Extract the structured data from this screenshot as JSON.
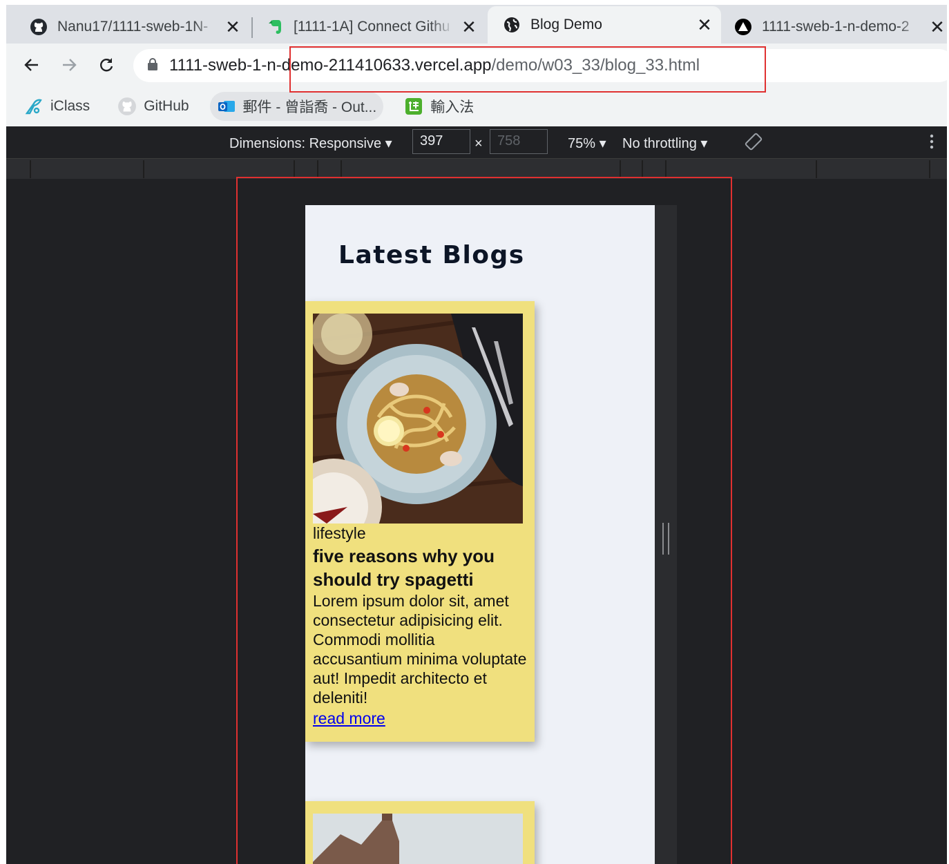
{
  "browser": {
    "tabs": [
      {
        "title": "Nanu17/1111-sweb-1N-",
        "icon": "github-icon",
        "active": false
      },
      {
        "title": "[1111-1A] Connect Githu",
        "icon": "evernote-icon",
        "active": false
      },
      {
        "title": "Blog Demo",
        "icon": "globe-icon",
        "active": true
      },
      {
        "title": "1111-sweb-1-n-demo-2",
        "icon": "vercel-icon",
        "active": false
      }
    ],
    "close_glyph": "✕",
    "url": {
      "host": "1111-sweb-1-n-demo-211410633.vercel.app",
      "path": "/demo/w03_33/blog_33.html"
    },
    "bookmarks": [
      {
        "label": "iClass",
        "icon": "iclass-icon"
      },
      {
        "label": "GitHub",
        "icon": "github-icon"
      },
      {
        "label": "郵件 - 曾詣喬 - Out...",
        "icon": "outlook-icon"
      },
      {
        "label": "輸入法",
        "icon": "speed-input-icon"
      }
    ]
  },
  "devtools": {
    "dimensions_label": "Dimensions: Responsive",
    "width": "397",
    "times": "×",
    "height": "758",
    "zoom": "75%",
    "throttling": "No throttling"
  },
  "page": {
    "heading": "Latest Blogs",
    "posts": [
      {
        "tag": "lifestyle",
        "title": "five reasons why you should try spagetti",
        "body": "Lorem ipsum dolor sit, amet consectetur adipisicing elit. Commodi mollitia accusantium minima voluptate aut! Impedit architecto et deleniti!",
        "link": "read more"
      }
    ]
  },
  "colors": {
    "card_bg": "#f0e07e",
    "page_bg": "#eef1f7",
    "highlight_border": "#e03030",
    "link": "#0000ee"
  }
}
